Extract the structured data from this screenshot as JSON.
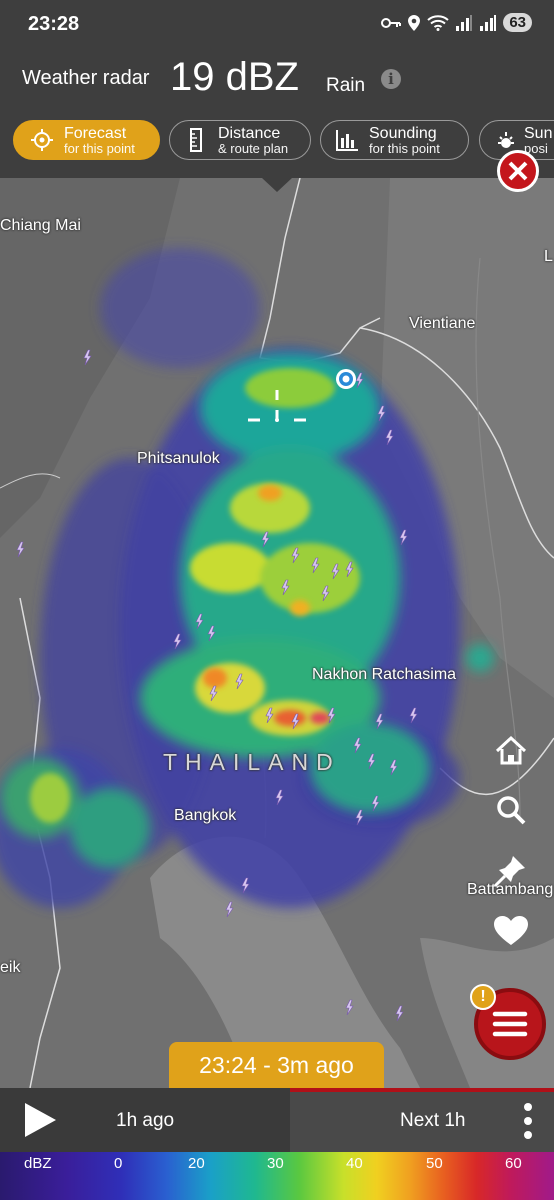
{
  "status_bar": {
    "time": "23:28",
    "battery": "63"
  },
  "header": {
    "title": "Weather radar",
    "value": "19 dBZ",
    "precip": "Rain",
    "info_icon": "info-icon"
  },
  "chips": [
    {
      "label": "Forecast",
      "sub": "for this point",
      "icon": "crosshair-icon"
    },
    {
      "label": "Distance",
      "sub": "& route plan",
      "icon": "ruler-icon"
    },
    {
      "label": "Sounding",
      "sub": "for this point",
      "icon": "sounding-chart-icon"
    },
    {
      "label": "Sun",
      "sub": "posi",
      "icon": "sun-icon"
    }
  ],
  "map": {
    "labels": {
      "chiang_mai": "Chiang Mai",
      "vientiane": "Vientiane",
      "phitsanulok": "Phitsanulok",
      "nakhon": "Nakhon Ratchasima",
      "bangkok": "Bangkok",
      "battambang": "Battambang",
      "eik": "eik",
      "l": "L"
    },
    "country": "THAILAND"
  },
  "timeline": {
    "current": "23:24 - 3m ago",
    "past": "1h ago",
    "next": "Next 1h"
  },
  "legend": {
    "unit": "dBZ",
    "ticks": [
      "0",
      "20",
      "30",
      "40",
      "50",
      "60"
    ]
  },
  "colors": {
    "accent": "#e0a21a",
    "danger": "#c4161c",
    "header_bg": "#3e3e3e"
  }
}
